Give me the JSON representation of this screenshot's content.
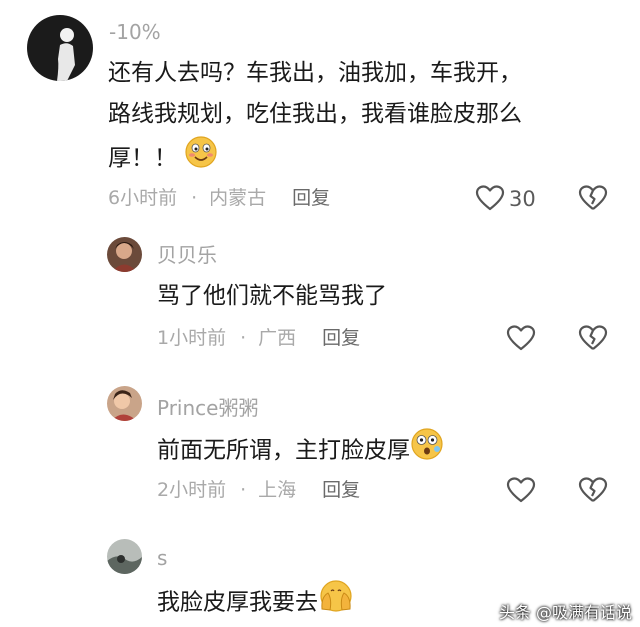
{
  "comments": [
    {
      "username": "-10%",
      "lines": [
        "还有人去吗？车我出，油我加，车我开，",
        "路线我规划，吃住我出，我看谁脸皮那么",
        "厚！！"
      ],
      "emoji": "smiling-face-emoji",
      "time": "6小时前",
      "location": "内蒙古",
      "reply": "回复",
      "likes": "30"
    },
    {
      "username": "贝贝乐",
      "lines": [
        "骂了他们就不能骂我了"
      ],
      "time": "1小时前",
      "location": "广西",
      "reply": "回复"
    },
    {
      "username": "Prince粥粥",
      "lines": [
        "前面无所谓，主打脸皮厚"
      ],
      "emoji": "flushed-face-emoji",
      "time": "2小时前",
      "location": "上海",
      "reply": "回复"
    },
    {
      "username": "s",
      "lines": [
        "我脸皮厚我要去"
      ],
      "emoji": "covering-face-emoji"
    }
  ],
  "watermark": "头条 @吸满有话说",
  "icons": {
    "like": "heart-outline-icon",
    "dislike": "broken-heart-icon"
  }
}
